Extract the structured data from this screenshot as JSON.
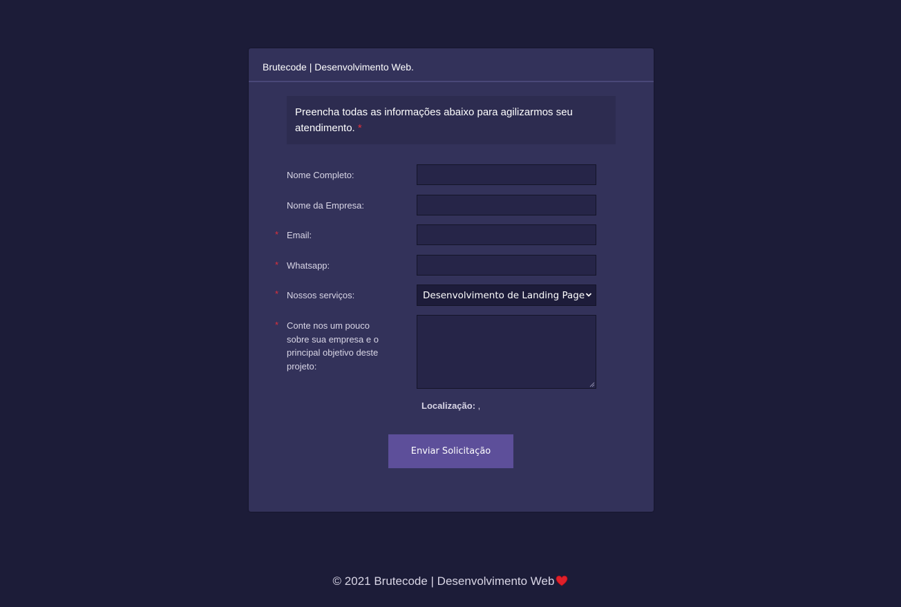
{
  "header": {
    "title": "Brutecode | Desenvolvimento Web."
  },
  "notice": {
    "text": "Preencha todas as informações abaixo para agilizarmos seu atendimento.",
    "required_mark": "*"
  },
  "form": {
    "required_mark": "*",
    "fields": {
      "full_name": {
        "label": "Nome Completo:",
        "value": ""
      },
      "company": {
        "label": "Nome da Empresa:",
        "value": ""
      },
      "email": {
        "label": "Email:",
        "value": ""
      },
      "whatsapp": {
        "label": "Whatsapp:",
        "value": ""
      },
      "services": {
        "label": "Nossos serviços:",
        "selected": "Desenvolvimento de Landing Page"
      },
      "about": {
        "label": "Conte nos um pouco sobre sua empresa e o principal objetivo deste projeto:",
        "value": ""
      }
    },
    "location": {
      "label": "Localização:",
      "value": ","
    },
    "submit_label": "Enviar Solicitação"
  },
  "footer": {
    "text": "© 2021 Brutecode | Desenvolvimento Web",
    "heart_icon": "heart-icon",
    "heart_color": "#e0202a"
  },
  "colors": {
    "background": "#1c1c38",
    "card": "#33325a",
    "accent_button": "#5d4f9a",
    "required": "#e0303a"
  }
}
